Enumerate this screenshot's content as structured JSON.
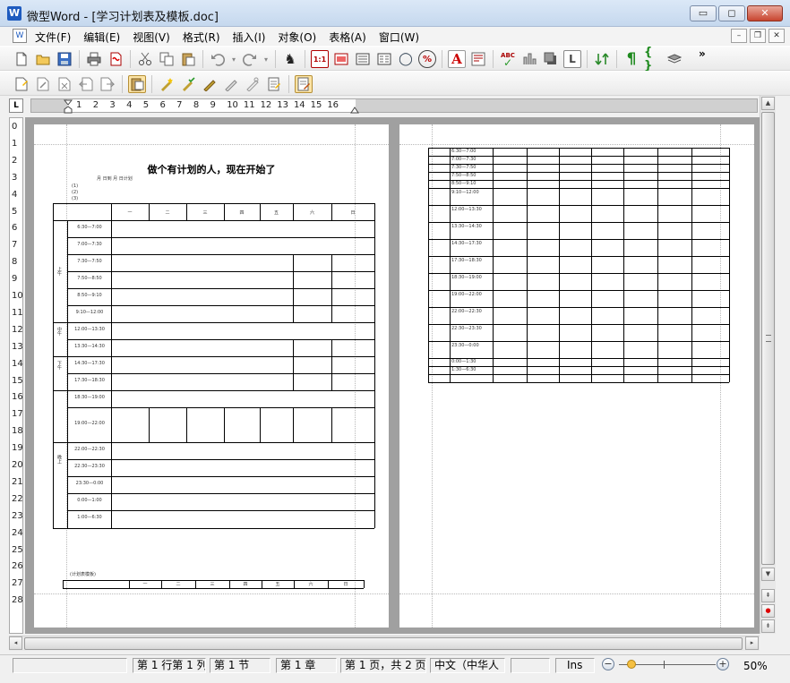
{
  "window": {
    "title": "微型Word - [学习计划表及模板.doc]",
    "app_icon": "W",
    "buttons": {
      "minimize": "▭",
      "maximize": "◻",
      "close": "✕"
    }
  },
  "menu": {
    "items": [
      "文件(F)",
      "编辑(E)",
      "视图(V)",
      "格式(R)",
      "插入(I)",
      "对象(O)",
      "表格(A)",
      "窗口(W)"
    ],
    "mdi_buttons": [
      "–",
      "❐",
      "✕"
    ]
  },
  "toolbar1": {
    "icons": [
      "new-doc-icon",
      "open-folder-icon",
      "save-icon",
      "print-icon",
      "pdf-icon",
      "cut-icon",
      "copy-icon",
      "paste-icon",
      "undo-icon",
      "redo-icon",
      "find-icon",
      "table-1to1-icon",
      "frame-icon",
      "columns-icon",
      "page-view-icon",
      "zoom-icon",
      "percent-icon",
      "font-a-icon",
      "paragraph-icon",
      "spellcheck-icon",
      "chart-icon",
      "shadow-icon",
      "letter-l-icon",
      "arrows-icon",
      "pilcrow-icon",
      "brackets-icon",
      "layers-icon"
    ],
    "more": "»",
    "glyphs": {
      "find": "♞",
      "table": "1:1",
      "zoom": "◯",
      "percent": "%",
      "font": "A",
      "spell": "ABC",
      "letter": "L",
      "pilcrow": "¶"
    }
  },
  "toolbar2": {
    "icons": [
      "insert-note-icon",
      "edit-note-icon",
      "delete-note-icon",
      "prev-note-icon",
      "next-note-icon",
      "clipboard-icon",
      "star-marker-icon",
      "check-marker-icon",
      "pen-marker-icon",
      "eraser-marker-icon",
      "link-marker-icon",
      "notebook-icon",
      "review-icon"
    ]
  },
  "ruler": {
    "corner": "L",
    "h_numbers": [
      "1",
      "2",
      "3",
      "4",
      "5",
      "6",
      "7",
      "8",
      "9",
      "10",
      "11",
      "12",
      "13",
      "14",
      "15",
      "16"
    ],
    "v_numbers": [
      "0",
      "1",
      "2",
      "3",
      "4",
      "5",
      "6",
      "7",
      "8",
      "9",
      "10",
      "11",
      "12",
      "13",
      "14",
      "15",
      "16",
      "17",
      "18",
      "19",
      "20",
      "21",
      "22",
      "23",
      "24",
      "25",
      "26",
      "27",
      "28"
    ]
  },
  "page1": {
    "title": "做个有计划的人，现在开始了",
    "subtitle": "月    日到    月    日计划",
    "notes": [
      "(1)",
      "(2)",
      "(3)"
    ],
    "day_headers": [
      "一",
      "二",
      "三",
      "四",
      "五",
      "六",
      "日"
    ],
    "period_labels": [
      "上午",
      "中午",
      "下午",
      "晚上"
    ],
    "times": [
      "6:30—7:00",
      "7:00—7:30",
      "7:30—7:50",
      "7:50—8:50",
      "8:50—9:10",
      "9:10—12:00",
      "12:00—13:30",
      "13:30—14:30",
      "14:30—17:30",
      "17:30—18:30",
      "18:30—19:00",
      "19:00—22:00",
      "22:00—22:30",
      "22:30—23:30",
      "23:30—0:00",
      "0:00—1:00",
      "1:00—6:30"
    ],
    "template_caption": "(计划表模板)",
    "template_headers": [
      "一",
      "二",
      "三",
      "四",
      "五",
      "六",
      "日"
    ]
  },
  "page2": {
    "times": [
      "6:30—7:00",
      "7:00—7:30",
      "7:30—7:50",
      "7:50—8:50",
      "8:50—9:10",
      "9:10—12:00",
      "12:00—13:30",
      "13:30—14:30",
      "14:30—17:30",
      "17:30—18:30",
      "18:30—19:00",
      "19:00—22:00",
      "22:00—22:30",
      "22:30—23:30",
      "23:30—0:00",
      "0:00—1:30",
      "1:30—6:30"
    ]
  },
  "scrollbars": {
    "up": "▲",
    "down": "▼",
    "left": "◂",
    "right": "▸",
    "prev_page": "⇞",
    "select_browse": "●",
    "next_page": "⇟"
  },
  "status": {
    "cells": [
      "",
      "第 1 行第 1 列",
      "第 1 节",
      "第 1 章",
      "第 1 页，共 2 页",
      "中文（中华人",
      "",
      "Ins"
    ],
    "zoom_minus": "−",
    "zoom_plus": "+",
    "zoom": "50%"
  }
}
